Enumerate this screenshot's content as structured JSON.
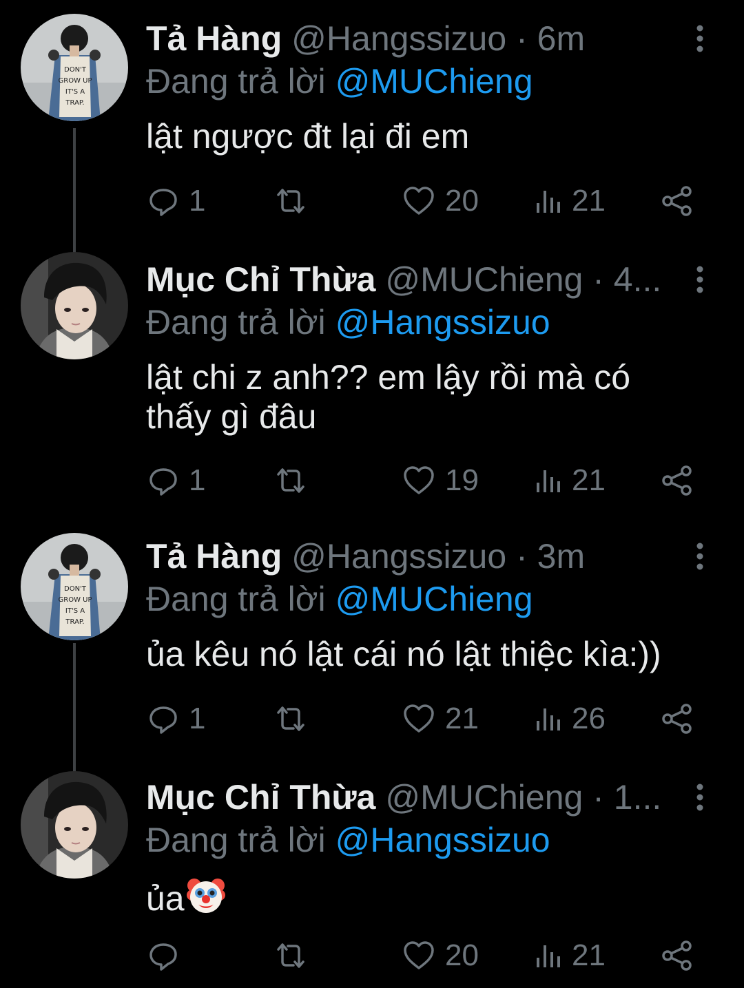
{
  "colors": {
    "background": "#000000",
    "text": "#e7e9ea",
    "muted": "#6e767d",
    "mention": "#1d9bf0",
    "thread_line": "#3e4144"
  },
  "tweets": [
    {
      "avatar_icon": "avatar-hangssizuo",
      "name": "Tả Hàng",
      "handle": "@Hangssizuo",
      "time": "6m",
      "reply_prefix": "Đang trả lời",
      "reply_to": "@MUChieng",
      "text": "lật ngược đt lại đi em",
      "replies": "1",
      "retweets": "",
      "likes": "20",
      "views": "21"
    },
    {
      "avatar_icon": "avatar-muchieng",
      "name": "Mục Chỉ Thừa",
      "handle": "@MUChieng",
      "time": "4...",
      "reply_prefix": "Đang trả lời",
      "reply_to": "@Hangssizuo",
      "text": "lật chi z anh?? em lậy rồi mà có thấy gì đâu",
      "replies": "1",
      "retweets": "",
      "likes": "19",
      "views": "21"
    },
    {
      "avatar_icon": "avatar-hangssizuo",
      "name": "Tả Hàng",
      "handle": "@Hangssizuo",
      "time": "3m",
      "reply_prefix": "Đang trả lời",
      "reply_to": "@MUChieng",
      "text": "ủa kêu nó lật cái nó lật thiệc kìa:))",
      "replies": "1",
      "retweets": "",
      "likes": "21",
      "views": "26"
    },
    {
      "avatar_icon": "avatar-muchieng",
      "name": "Mục Chỉ Thừa",
      "handle": "@MUChieng",
      "time": "1...",
      "reply_prefix": "Đang trả lời",
      "reply_to": "@Hangssizuo",
      "text": "ủa",
      "text_emoji": "clown-face-emoji",
      "replies": "",
      "retweets": "",
      "likes": "20",
      "views": "21"
    }
  ]
}
